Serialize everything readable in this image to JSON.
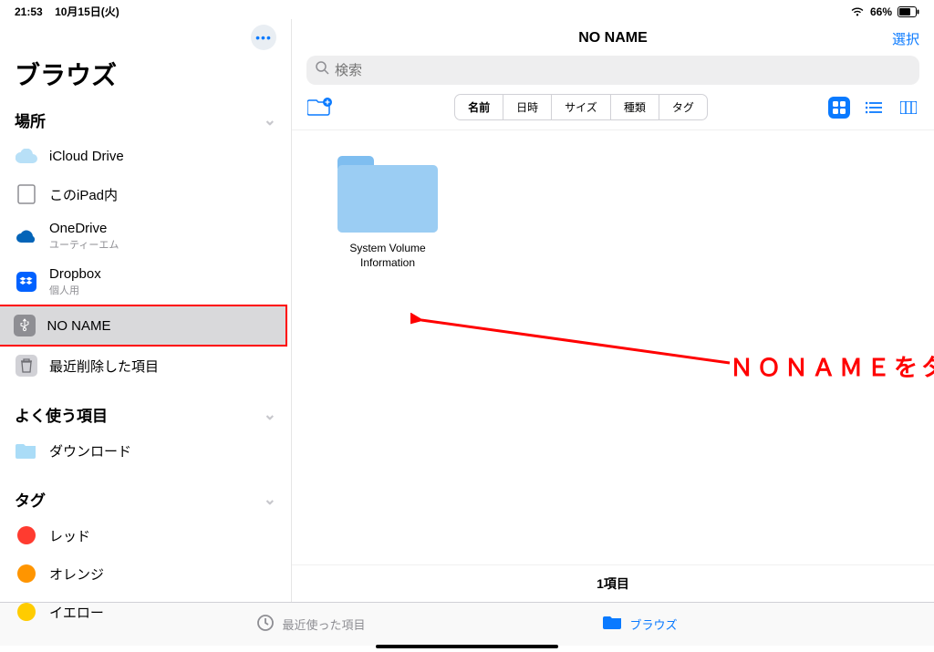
{
  "status": {
    "time": "21:53",
    "date": "10月15日(火)",
    "battery": "66%"
  },
  "sidebar": {
    "title": "ブラウズ",
    "sections": {
      "locations": {
        "header": "場所",
        "items": [
          {
            "label": "iCloud Drive",
            "sub": ""
          },
          {
            "label": "このiPad内",
            "sub": ""
          },
          {
            "label": "OneDrive",
            "sub": "ユーティーエム"
          },
          {
            "label": "Dropbox",
            "sub": "個人用"
          },
          {
            "label": "NO NAME",
            "sub": ""
          },
          {
            "label": "最近削除した項目",
            "sub": ""
          }
        ]
      },
      "favorites": {
        "header": "よく使う項目",
        "items": [
          {
            "label": "ダウンロード"
          }
        ]
      },
      "tags": {
        "header": "タグ",
        "items": [
          {
            "label": "レッド",
            "color": "#ff3b30"
          },
          {
            "label": "オレンジ",
            "color": "#ff9500"
          },
          {
            "label": "イエロー",
            "color": "#ffcc00"
          }
        ]
      }
    }
  },
  "content": {
    "title": "NO NAME",
    "select": "選択",
    "search_placeholder": "検索",
    "sort": {
      "name": "名前",
      "date": "日時",
      "size": "サイズ",
      "kind": "種類",
      "tag": "タグ"
    },
    "folder": {
      "name": "System Volume\nInformation"
    },
    "count": "1項目"
  },
  "annotation": "ＮＯＮＡＭＥをタッチ",
  "tabbar": {
    "recents": "最近使った項目",
    "browse": "ブラウズ"
  }
}
